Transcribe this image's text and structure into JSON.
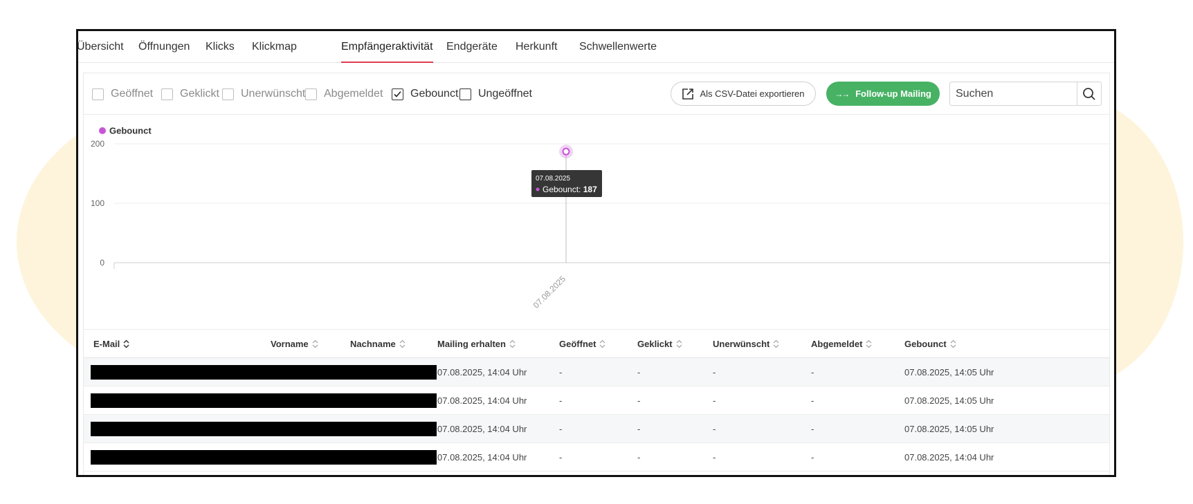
{
  "tabs": [
    {
      "label": "Übersicht"
    },
    {
      "label": "Öffnungen"
    },
    {
      "label": "Klicks"
    },
    {
      "label": "Klickmap"
    },
    {
      "label": "Empfängeraktivität",
      "active": true
    },
    {
      "label": "Endgeräte"
    },
    {
      "label": "Herkunft"
    },
    {
      "label": "Schwellenwerte"
    }
  ],
  "filters": [
    {
      "label": "Geöffnet",
      "checked": false
    },
    {
      "label": "Geklickt",
      "checked": false
    },
    {
      "label": "Unerwünscht",
      "checked": false
    },
    {
      "label": "Abgemeldet",
      "checked": false
    },
    {
      "label": "Gebounct",
      "checked": true
    },
    {
      "label": "Ungeöffnet",
      "checked": false
    }
  ],
  "toolbar": {
    "csv_label": "Als CSV-Datei exportieren",
    "followup_label": "Follow-up Mailing",
    "search_placeholder": "Suchen"
  },
  "colors": {
    "accent_tab": "#e03a50",
    "followup_green": "#47b264",
    "series_gebounct": "#c855d8"
  },
  "chart_data": {
    "type": "line",
    "legend": "top-left",
    "ylim": [
      0,
      200
    ],
    "yticks": [
      0,
      100,
      200
    ],
    "grid": true,
    "x": [
      "07.08.2025"
    ],
    "series": [
      {
        "name": "Gebounct",
        "values": [
          187
        ]
      }
    ],
    "tooltip": {
      "date": "07.08.2025",
      "label": "Gebounct:",
      "value": "187"
    }
  },
  "table": {
    "columns": [
      "E-Mail",
      "Vorname",
      "Nachname",
      "Mailing erhalten",
      "Geöffnet",
      "Geklickt",
      "Unerwünscht",
      "Abgemeldet",
      "Gebounct"
    ],
    "rows": [
      {
        "mailing": "07.08.2025, 14:04 Uhr",
        "geoeffnet": "-",
        "geklickt": "-",
        "unerwuenscht": "-",
        "abgemeldet": "-",
        "gebounct": "07.08.2025, 14:05 Uhr"
      },
      {
        "mailing": "07.08.2025, 14:04 Uhr",
        "geoeffnet": "-",
        "geklickt": "-",
        "unerwuenscht": "-",
        "abgemeldet": "-",
        "gebounct": "07.08.2025, 14:05 Uhr"
      },
      {
        "mailing": "07.08.2025, 14:04 Uhr",
        "geoeffnet": "-",
        "geklickt": "-",
        "unerwuenscht": "-",
        "abgemeldet": "-",
        "gebounct": "07.08.2025, 14:05 Uhr"
      },
      {
        "mailing": "07.08.2025, 14:04 Uhr",
        "geoeffnet": "-",
        "geklickt": "-",
        "unerwuenscht": "-",
        "abgemeldet": "-",
        "gebounct": "07.08.2025, 14:04 Uhr"
      }
    ]
  }
}
